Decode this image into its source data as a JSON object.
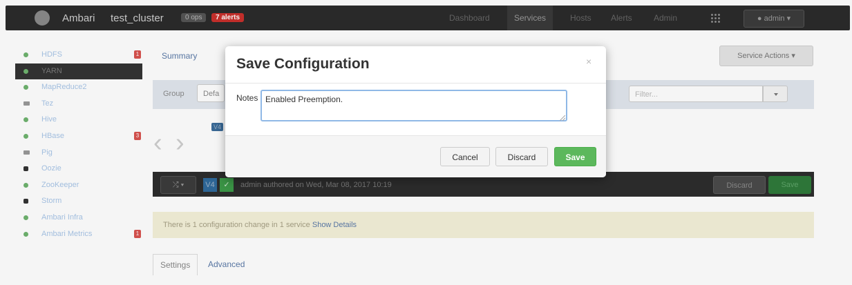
{
  "topnav": {
    "brand": "Ambari",
    "cluster": "test_cluster",
    "ops_badge": "0 ops",
    "alerts_badge": "7 alerts",
    "links": [
      "Dashboard",
      "Services",
      "Hosts",
      "Alerts",
      "Admin"
    ],
    "active_link": "Services",
    "user": "admin"
  },
  "sidebar": {
    "items": [
      {
        "label": "HDFS",
        "badge": "1",
        "status": "green"
      },
      {
        "label": "YARN",
        "badge": "",
        "status": "green"
      },
      {
        "label": "MapReduce2",
        "badge": "",
        "status": "green"
      },
      {
        "label": "Tez",
        "badge": "",
        "status": "client"
      },
      {
        "label": "Hive",
        "badge": "",
        "status": "green"
      },
      {
        "label": "HBase",
        "badge": "3",
        "status": "green"
      },
      {
        "label": "Pig",
        "badge": "",
        "status": "client"
      },
      {
        "label": "Oozie",
        "badge": "",
        "status": "dark"
      },
      {
        "label": "ZooKeeper",
        "badge": "",
        "status": "green"
      },
      {
        "label": "Storm",
        "badge": "",
        "status": "dark"
      },
      {
        "label": "Ambari Infra",
        "badge": "",
        "status": "green"
      },
      {
        "label": "Ambari Metrics",
        "badge": "1",
        "status": "green"
      }
    ]
  },
  "main": {
    "summary_tab": "Summary",
    "service_actions": "Service Actions ▾",
    "group_label": "Group",
    "group_value": "Defa",
    "filter_placeholder": "Filter...",
    "version_badge": "V4",
    "shuffle_label": "⤮ ▾",
    "check_glyph": "✓",
    "authored_text": "admin authored on Wed, Mar 08, 2017 10:19",
    "discard_label": "Discard",
    "save_label": "Save",
    "change_text": "There is 1 configuration change in 1 service",
    "show_details": "Show Details",
    "bottom_tabs": [
      "Settings",
      "Advanced"
    ],
    "arrows": [
      "‹",
      "›"
    ]
  },
  "modal": {
    "title": "Save Configuration",
    "close_glyph": "×",
    "notes_label": "Notes",
    "notes_value": "Enabled Preemption.",
    "cancel_label": "Cancel",
    "discard_label": "Discard",
    "save_label": "Save"
  }
}
